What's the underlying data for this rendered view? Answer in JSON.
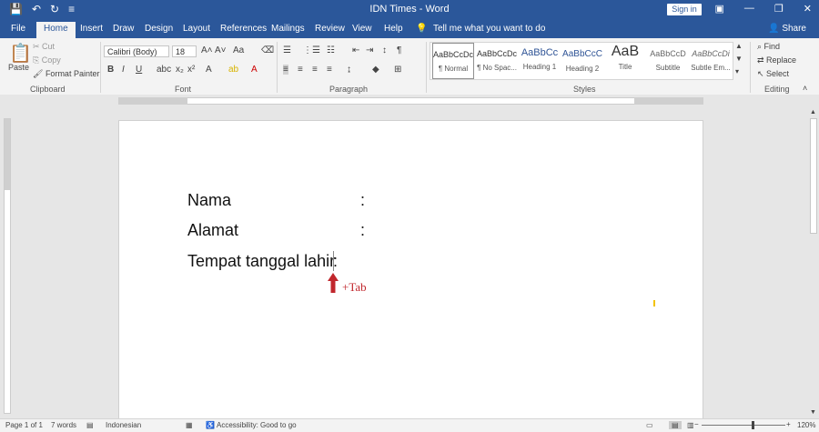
{
  "window": {
    "title": "IDN Times  -  Word",
    "sign_in": "Sign in",
    "share": "Share"
  },
  "qat": {
    "save_icon": "save-icon",
    "undo_icon": "undo-icon",
    "redo_icon": "redo-icon",
    "customize_icon": "customize-icon"
  },
  "tabs": [
    "File",
    "Home",
    "Insert",
    "Draw",
    "Design",
    "Layout",
    "References",
    "Mailings",
    "Review",
    "View",
    "Help"
  ],
  "tell_me": "Tell me what you want to do",
  "ribbon": {
    "clipboard": {
      "label": "Clipboard",
      "paste": "Paste",
      "cut": "Cut",
      "copy": "Copy",
      "format_painter": "Format Painter"
    },
    "font": {
      "label": "Font",
      "font_name": "Calibri (Body)",
      "font_size": "18"
    },
    "paragraph": {
      "label": "Paragraph"
    },
    "styles": {
      "label": "Styles",
      "items": [
        {
          "sample": "AaBbCcDc",
          "name": "¶ Normal"
        },
        {
          "sample": "AaBbCcDc",
          "name": "¶ No Spac..."
        },
        {
          "sample": "AaBbCc",
          "name": "Heading 1"
        },
        {
          "sample": "AaBbCcC",
          "name": "Heading 2"
        },
        {
          "sample": "AaB",
          "name": "Title"
        },
        {
          "sample": "AaBbCcD",
          "name": "Subtitle"
        },
        {
          "sample": "AaBbCcDi",
          "name": "Subtle Em..."
        }
      ]
    },
    "editing": {
      "label": "Editing",
      "find": "Find",
      "replace": "Replace",
      "select": "Select"
    }
  },
  "document": {
    "lines": [
      {
        "label": "Nama",
        "colon": ":"
      },
      {
        "label": "Alamat",
        "colon": ":"
      },
      {
        "label": "Tempat tanggal lahir",
        "colon": ":"
      }
    ],
    "annotation": "+Tab"
  },
  "status": {
    "page": "Page 1 of 1",
    "words": "7 words",
    "language": "Indonesian",
    "accessibility": "Accessibility: Good to go",
    "zoom": "120%"
  },
  "colors": {
    "brand": "#2b579a",
    "annotation": "#c1272d"
  }
}
